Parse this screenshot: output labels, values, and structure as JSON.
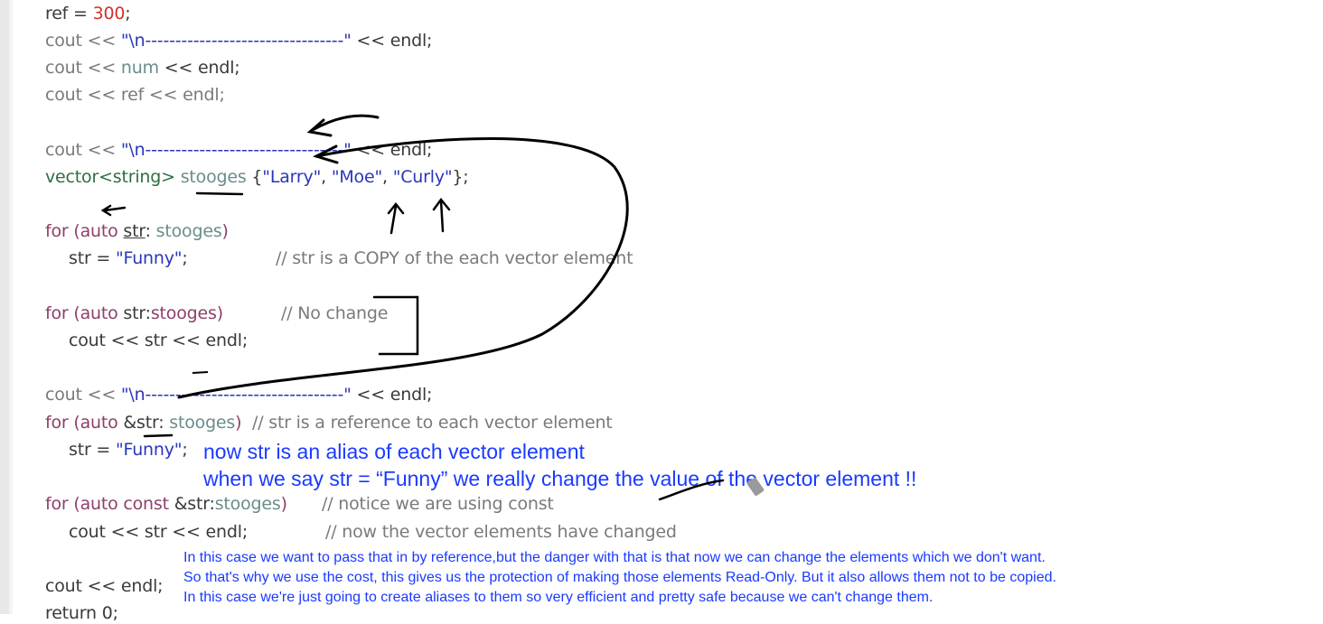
{
  "colors": {
    "keyword": "#8e3f6a",
    "type": "#2e6e40",
    "string": "#2a36b8",
    "number": "#d2312a",
    "comment": "#7a7a7a",
    "annotation": "#1a3aff"
  },
  "code": {
    "l1": {
      "a": "ref = ",
      "b": "300",
      "c": ";"
    },
    "l2": {
      "a": "cout << ",
      "b": "\"\\n---------------------------------\"",
      "c": " << endl;"
    },
    "l3": {
      "a": "cout << ",
      "b": "num",
      "c": " << endl;"
    },
    "l4": {
      "a": "cout << ref << endl;"
    },
    "l5": {
      "a": "cout << ",
      "b": "\"\\n---------------------------------\"",
      "c": " << endl;"
    },
    "l6": {
      "a": "vector<string>",
      "b": " stooges ",
      "c": "{",
      "d": "\"Larry\"",
      "e": ", ",
      "f": "\"Moe\"",
      "g": ", ",
      "h": "\"Curly\"",
      "i": "};"
    },
    "l7": {
      "a": "for (auto ",
      "b": "str",
      "c": ": ",
      "d": "stooges",
      "e": ")"
    },
    "l8": {
      "a": "str = ",
      "b": "\"Funny\"",
      "c": ";",
      "d": "// str is a COPY of the each vector element"
    },
    "l9": {
      "a": "for (auto ",
      "b": "str:",
      "c": "stooges",
      "d": ")",
      "e": "// No change"
    },
    "l10": {
      "a": "cout << str << endl;"
    },
    "l11": {
      "a": "cout << ",
      "b": "\"\\n---------------------------------\"",
      "c": " << endl;"
    },
    "l12": {
      "a": "for (auto ",
      "b": "&str:",
      "c": " stooges",
      "d": ")",
      "e": "  // str is a reference to each vector element"
    },
    "l13": {
      "a": "str = ",
      "b": "\"Funny\"",
      "c": ";"
    },
    "l14": {
      "a": "for (auto const ",
      "b": "&str:",
      "c": "stooges",
      "d": ")",
      "e": "// notice we are using const"
    },
    "l15": {
      "a": "cout << str << endl;",
      "b": "// now the vector elements have changed"
    },
    "l16": {
      "a": "cout << endl;"
    },
    "l17": {
      "a": "return 0;"
    }
  },
  "annotations": {
    "line1": "now str is an alias of each vector element",
    "line2": "when we say str = “Funny” we really change the value of the vector element !!",
    "note1": "In this case we want to pass that in by reference,but the danger with that is that now we can change the elements which we don't want.",
    "note2": "So that's why we use the cost, this gives us the protection of making those elements Read-Only. But it also allows them not to be copied.",
    "note3": "In this case we're just going to create aliases to them so very efficient and pretty safe because we can't change them."
  }
}
